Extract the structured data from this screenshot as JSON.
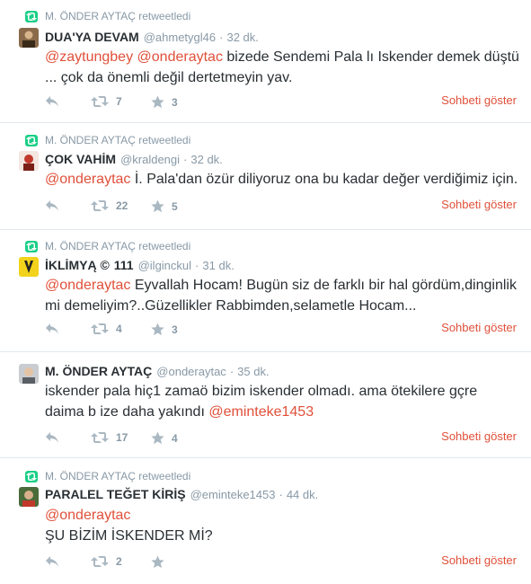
{
  "tweets": [
    {
      "retweeted_by": "M. ÖNDER AYTAÇ retweetledi",
      "name": "DUA'YA DEVAM",
      "handle": "@ahmetygl46",
      "time": "32 dk.",
      "mentions_line1": [
        "@zaytungbey",
        "@onderaytac"
      ],
      "text_line1": " bizede Sendemi Pala lı Iskender demek düştü",
      "text_line2": "... çok da önemli değil dertetmeyin yav.",
      "retweets": "7",
      "favorites": "3",
      "conversation": "Sohbeti göster",
      "avatar_color": "#8a6a4a"
    },
    {
      "retweeted_by": "M. ÖNDER AYTAÇ retweetledi",
      "name": "ÇOK VAHİM",
      "handle": "@kraldengi",
      "time": "32 dk.",
      "mention": "@onderaytac",
      "text_line1": " İ. Pala'dan özür diliyoruz ona bu kadar değer verdiğimiz için.",
      "retweets": "22",
      "favorites": "5",
      "conversation": "Sohbeti göster",
      "avatar_color": "#c0392b"
    },
    {
      "retweeted_by": "M. ÖNDER AYTAÇ retweetledi",
      "name": "İKLİMYĄ ©",
      "name_extra": "111",
      "handle": "@ilginckul",
      "time": "31 dk.",
      "mention": "@onderaytac",
      "text_line1": " Eyvallah Hocam! Bugün siz de farklı bir hal gördüm,dinginlik",
      "text_line2": "mi demeliyim?..Güzellikler Rabbimden,selametle Hocam...",
      "retweets": "4",
      "favorites": "3",
      "conversation": "Sohbeti göster",
      "avatar_color": "#f2d21b"
    },
    {
      "name": "M. ÖNDER AYTAÇ",
      "handle": "@onderaytac",
      "time": "35 dk.",
      "text_line1": "iskender pala hiç1 zamaö bizim iskender olmadı. ama ötekilere gçre",
      "text_line2_plain": "daima b ize daha yakındı ",
      "mention": "@eminteke1453",
      "retweets": "17",
      "favorites": "4",
      "conversation": "Sohbeti göster",
      "avatar_color": "#9aa0a6"
    },
    {
      "retweeted_by": "M. ÖNDER AYTAÇ retweetledi",
      "name": "PARALEL TEĞET KİRİŞ",
      "handle": "@eminteke1453",
      "time": "44 dk.",
      "mention": "@onderaytac",
      "text_line2": "ŞU BİZİM İSKENDER Mİ?",
      "retweets": "2",
      "conversation": "Sohbeti göster",
      "avatar_color": "#4a6b3a"
    }
  ],
  "colors": {
    "accent": "#e0503a",
    "muted": "#8899a6",
    "retweet_green": "#19cf86"
  },
  "dot": "·"
}
